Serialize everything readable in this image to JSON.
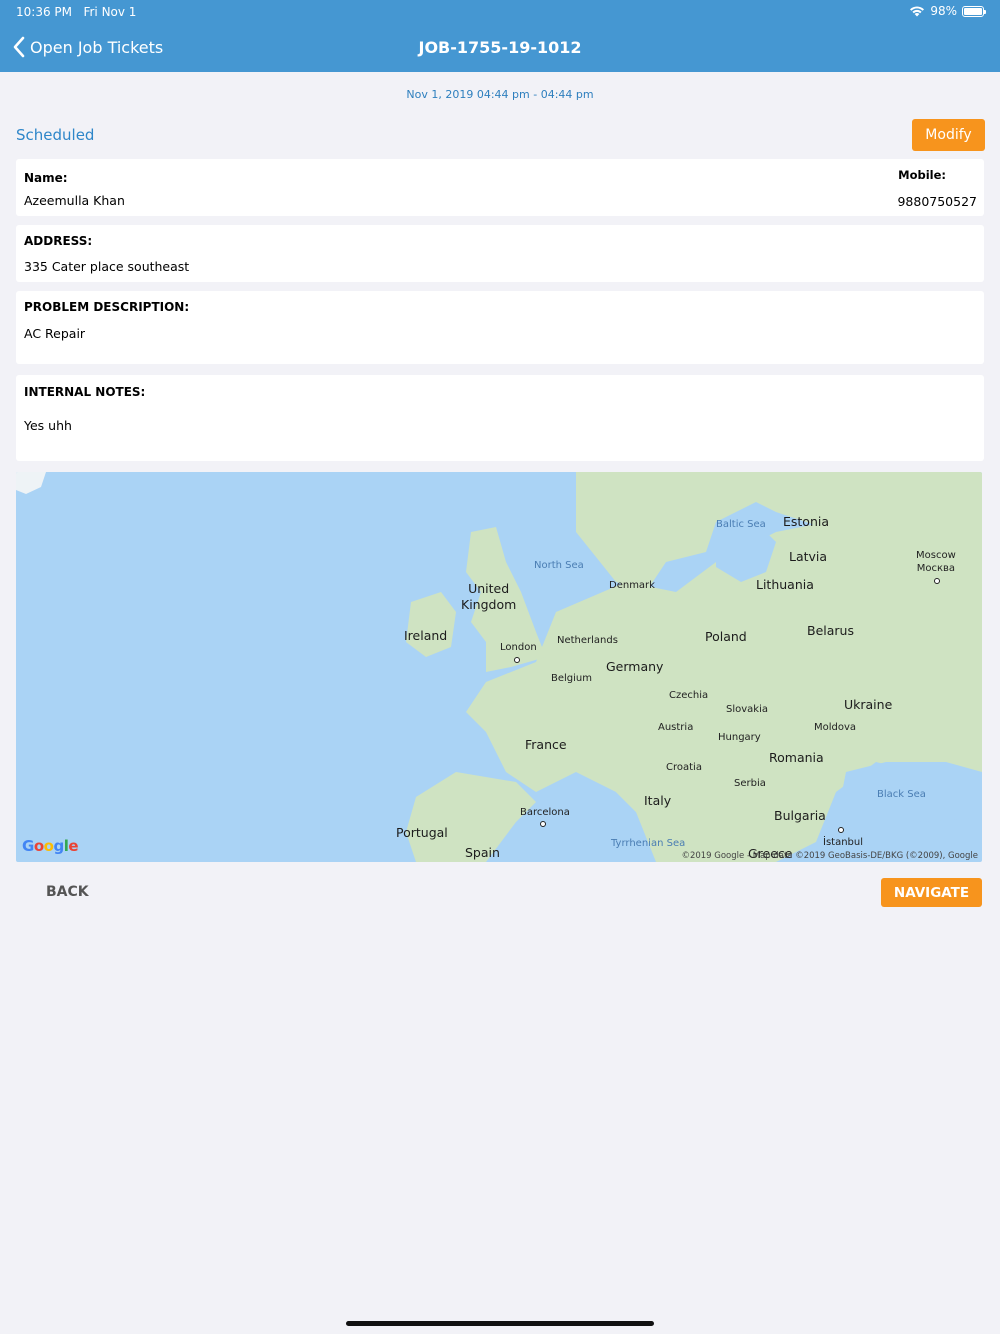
{
  "status_bar": {
    "time": "10:36 PM",
    "date": "Fri Nov 1",
    "battery": "98%",
    "battery_level": 0.98
  },
  "nav": {
    "back_label": "Open Job Tickets",
    "title": "JOB-1755-19-1012"
  },
  "job": {
    "datetime": "Nov 1, 2019 04:44 pm - 04:44 pm",
    "status": "Scheduled",
    "modify_label": "Modify"
  },
  "customer": {
    "name_label": "Name:",
    "name": "Azeemulla Khan",
    "mobile_label": "Mobile:",
    "mobile": "9880750527"
  },
  "address": {
    "label": "ADDRESS:",
    "value": "335 Cater place southeast"
  },
  "problem": {
    "label": "PROBLEM DESCRIPTION:",
    "value": "AC Repair"
  },
  "notes": {
    "label": "INTERNAL NOTES:",
    "value": "Yes uhh"
  },
  "map": {
    "labels": {
      "estonia": "Estonia",
      "latvia": "Latvia",
      "lithuania": "Lithuania",
      "moscow": "Moscow\nМосква",
      "baltic_sea": "Baltic Sea",
      "north_sea": "North Sea",
      "denmark": "Denmark",
      "uk": "United\nKingdom",
      "ireland": "Ireland",
      "london": "London",
      "netherlands": "Netherlands",
      "poland": "Poland",
      "belarus": "Belarus",
      "germany": "Germany",
      "belgium": "Belgium",
      "czechia": "Czechia",
      "slovakia": "Slovakia",
      "ukraine": "Ukraine",
      "austria": "Austria",
      "moldova": "Moldova",
      "hungary": "Hungary",
      "france": "France",
      "romania": "Romania",
      "croatia": "Croatia",
      "serbia": "Serbia",
      "black_sea": "Black Sea",
      "italy": "Italy",
      "barcelona": "Barcelona",
      "bulgaria": "Bulgaria",
      "portugal": "Portugal",
      "spain": "Spain",
      "tyrrhenian_sea": "Tyrrhenian Sea",
      "istanbul": "İstanbul",
      "greece": "Greece"
    },
    "google": "Google",
    "attribution": "©2019 Google - Map data ©2019 GeoBasis-DE/BKG (©2009), Google"
  },
  "actions": {
    "back_label": "BACK",
    "navigate_label": "NAVIGATE"
  },
  "colors": {
    "header": "#4597d2",
    "accent": "#f7941d",
    "link": "#2e86c9",
    "water": "#aad3f5",
    "land": "#cfe3c2"
  }
}
